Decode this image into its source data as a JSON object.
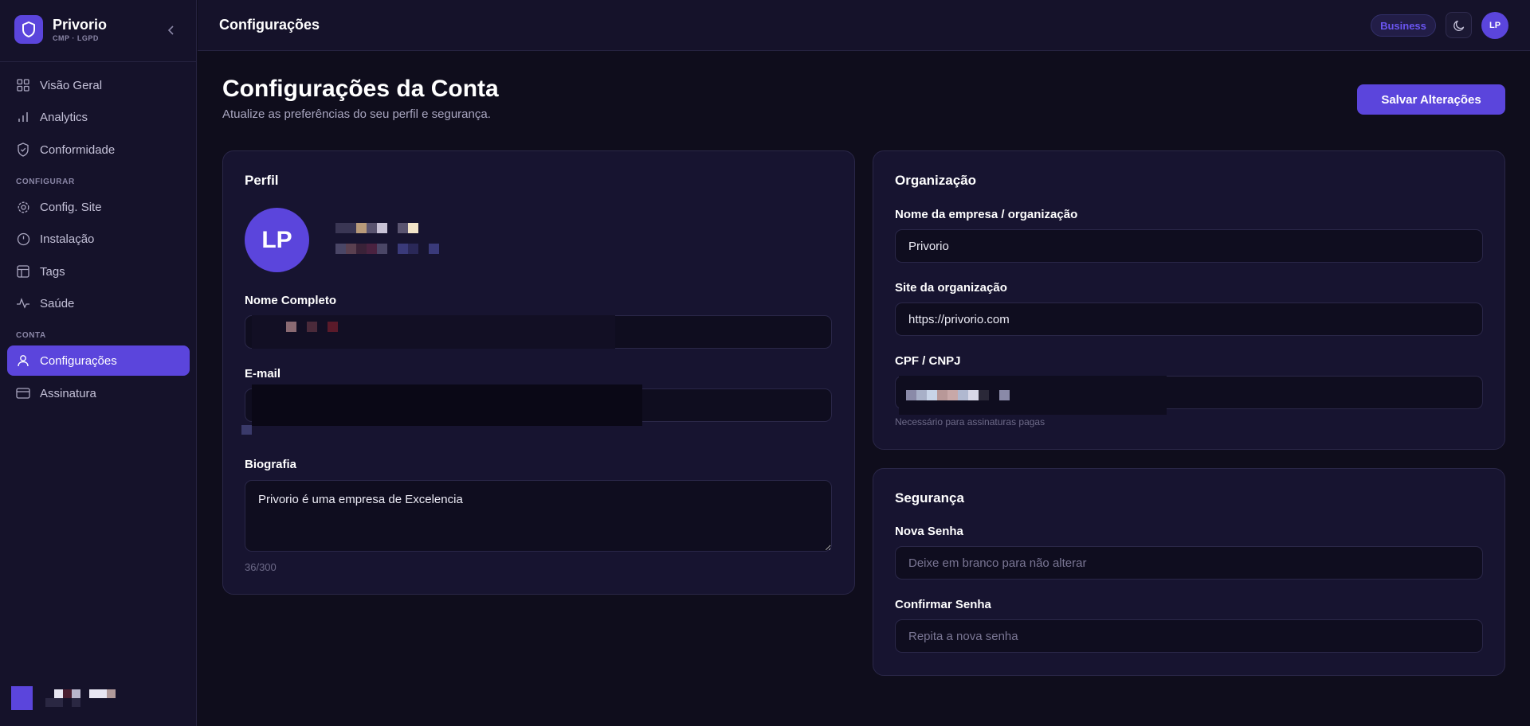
{
  "brand": {
    "name": "Privorio",
    "subtitle": "CMP · LGPD"
  },
  "sidebar": {
    "items": [
      {
        "label": "Visão Geral",
        "icon": "grid-icon"
      },
      {
        "label": "Analytics",
        "icon": "bar-chart-icon"
      },
      {
        "label": "Conformidade",
        "icon": "shield-check-icon"
      }
    ],
    "section_configurar": "CONFIGURAR",
    "config_items": [
      {
        "label": "Config. Site",
        "icon": "gear-icon"
      },
      {
        "label": "Instalação",
        "icon": "clock-icon"
      },
      {
        "label": "Tags",
        "icon": "layout-icon"
      },
      {
        "label": "Saúde",
        "icon": "pulse-icon"
      }
    ],
    "section_conta": "CONTA",
    "conta_items": [
      {
        "label": "Configurações",
        "icon": "user-icon",
        "active": true
      },
      {
        "label": "Assinatura",
        "icon": "credit-card-icon"
      }
    ]
  },
  "topbar": {
    "title": "Configurações",
    "plan_badge": "Business",
    "avatar_initials": "LP"
  },
  "header": {
    "title": "Configurações da Conta",
    "subtitle": "Atualize as preferências do seu perfil e segurança.",
    "save_label": "Salvar Alterações"
  },
  "profile": {
    "title": "Perfil",
    "avatar_initials": "LP",
    "full_name_label": "Nome Completo",
    "email_label": "E-mail",
    "bio_label": "Biografia",
    "bio_value": "Privorio é uma empresa de Excelencia",
    "bio_counter": "36/300"
  },
  "organization": {
    "title": "Organização",
    "company_label": "Nome da empresa / organização",
    "company_value": "Privorio",
    "site_label": "Site da organização",
    "site_value": "https://privorio.com",
    "doc_label": "CPF / CNPJ",
    "doc_hint": "Necessário para assinaturas pagas"
  },
  "security": {
    "title": "Segurança",
    "new_password_label": "Nova Senha",
    "new_password_placeholder": "Deixe em branco para não alterar",
    "confirm_password_label": "Confirmar Senha",
    "confirm_password_placeholder": "Repita a nova senha"
  },
  "colors": {
    "accent": "#5b45dc",
    "background": "#0f0d1c",
    "sidebar": "#15122a",
    "card": "#171430"
  }
}
